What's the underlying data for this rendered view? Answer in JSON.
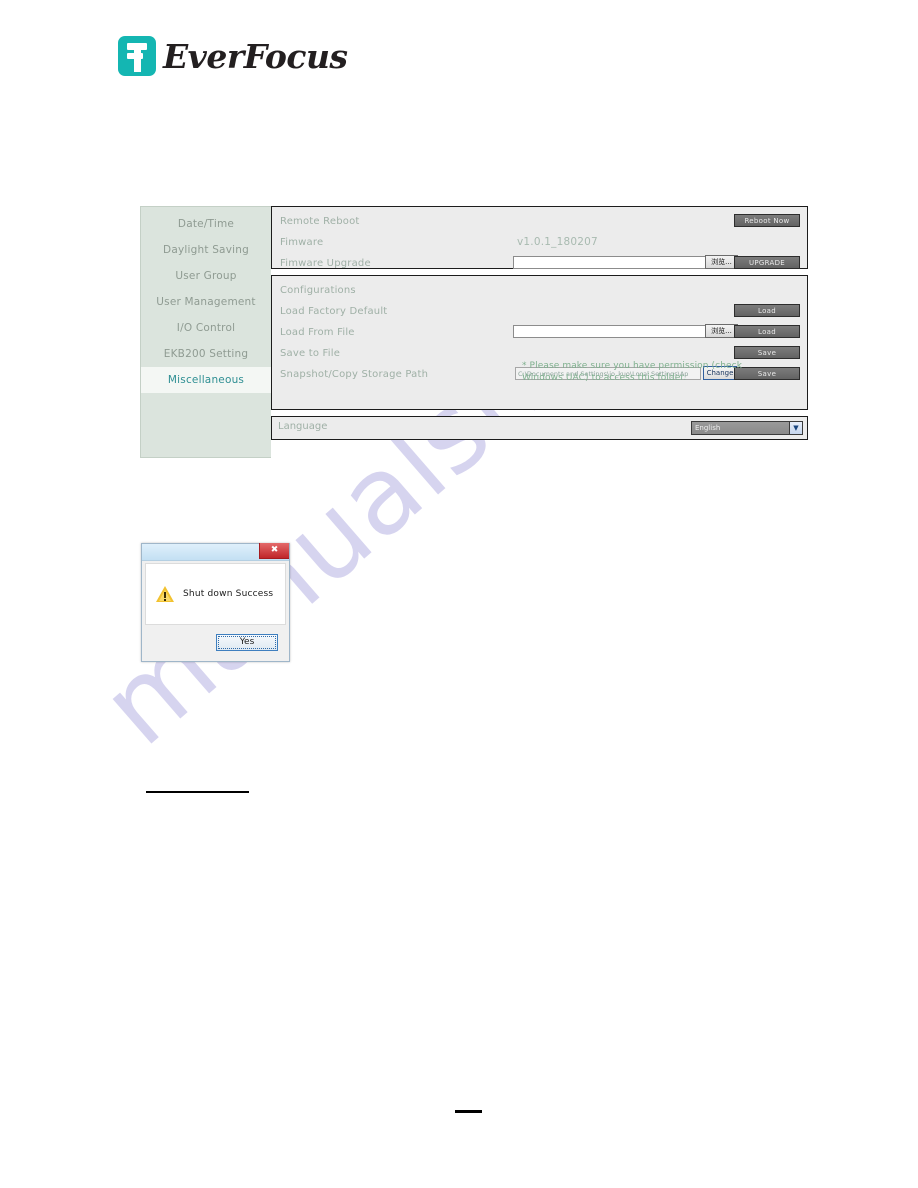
{
  "brand": {
    "name": "EverFocus",
    "logo_icon": "everfocus-f-logo-icon",
    "accent_color": "#14b6b2"
  },
  "watermark": {
    "text": "manualshive.com",
    "color": "#c9c6ea"
  },
  "settings_app": {
    "sidebar": {
      "items": [
        {
          "label": "Date/Time",
          "active": false
        },
        {
          "label": "Daylight Saving",
          "active": false
        },
        {
          "label": "User Group",
          "active": false
        },
        {
          "label": "User Management",
          "active": false
        },
        {
          "label": "I/O Control",
          "active": false
        },
        {
          "label": "EKB200 Setting",
          "active": false
        },
        {
          "label": "Miscellaneous",
          "active": true
        }
      ],
      "active_label": "Miscellaneous",
      "active_color": "#2f8f93",
      "background_color": "#dbe4dd"
    },
    "firmware_panel": {
      "remote_reboot_label": "Remote Reboot",
      "reboot_now_button": "Reboot Now",
      "firmware_label": "Fimware",
      "firmware_version": "v1.0.1_180207",
      "firmware_upgrade_label": "Fimware Upgrade",
      "firmware_upgrade_value": "",
      "browse_button": "浏览...",
      "upgrade_button": "UPGRADE"
    },
    "configurations_panel": {
      "title": "Configurations",
      "load_factory_default_label": "Load Factory Default",
      "load_factory_default_button": "Load",
      "load_from_file_label": "Load From File",
      "load_from_file_value": "",
      "load_from_file_browse_button": "浏览...",
      "load_from_file_button": "Load",
      "save_to_file_label": "Save to File",
      "save_to_file_button": "Save",
      "snapshot_path_label": "Snapshot/Copy Storage Path",
      "snapshot_path_value": "C:\\Documents and Settings\\jo_kuo\\Local Settings\\Ap",
      "snapshot_change_button": "Change",
      "snapshot_save_button": "Save",
      "uac_note": "* Please make sure you have permission (check Windows UAC) to access this folder.",
      "uac_note_color": "#7fb08e"
    },
    "language_panel": {
      "label": "Language",
      "selected": "English",
      "dropdown_icon": "chevron-down-icon"
    }
  },
  "dialog": {
    "title": "",
    "close_icon": "close-icon",
    "warning_icon": "warning-triangle-icon",
    "message": "Shut down Success",
    "confirm_button": "Yes"
  }
}
